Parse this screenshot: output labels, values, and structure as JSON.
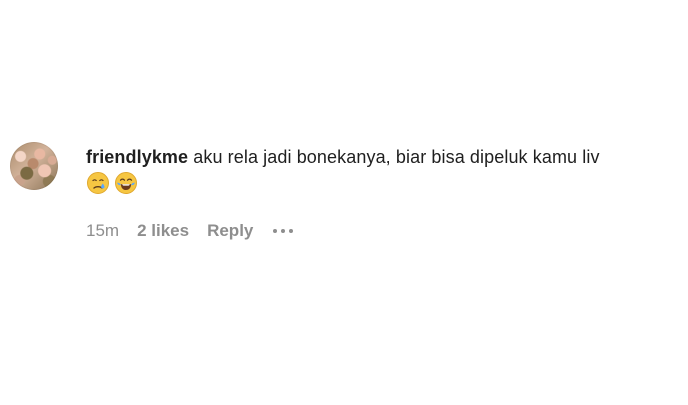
{
  "comment": {
    "username": "friendlykme",
    "text": " aku rela jadi bonekanya, biar bisa dipeluk kamu liv",
    "emojis": [
      "😢",
      "😂"
    ],
    "time": "15m",
    "likes": "2 likes",
    "reply_label": "Reply",
    "more_icon": "ellipsis-icon"
  }
}
